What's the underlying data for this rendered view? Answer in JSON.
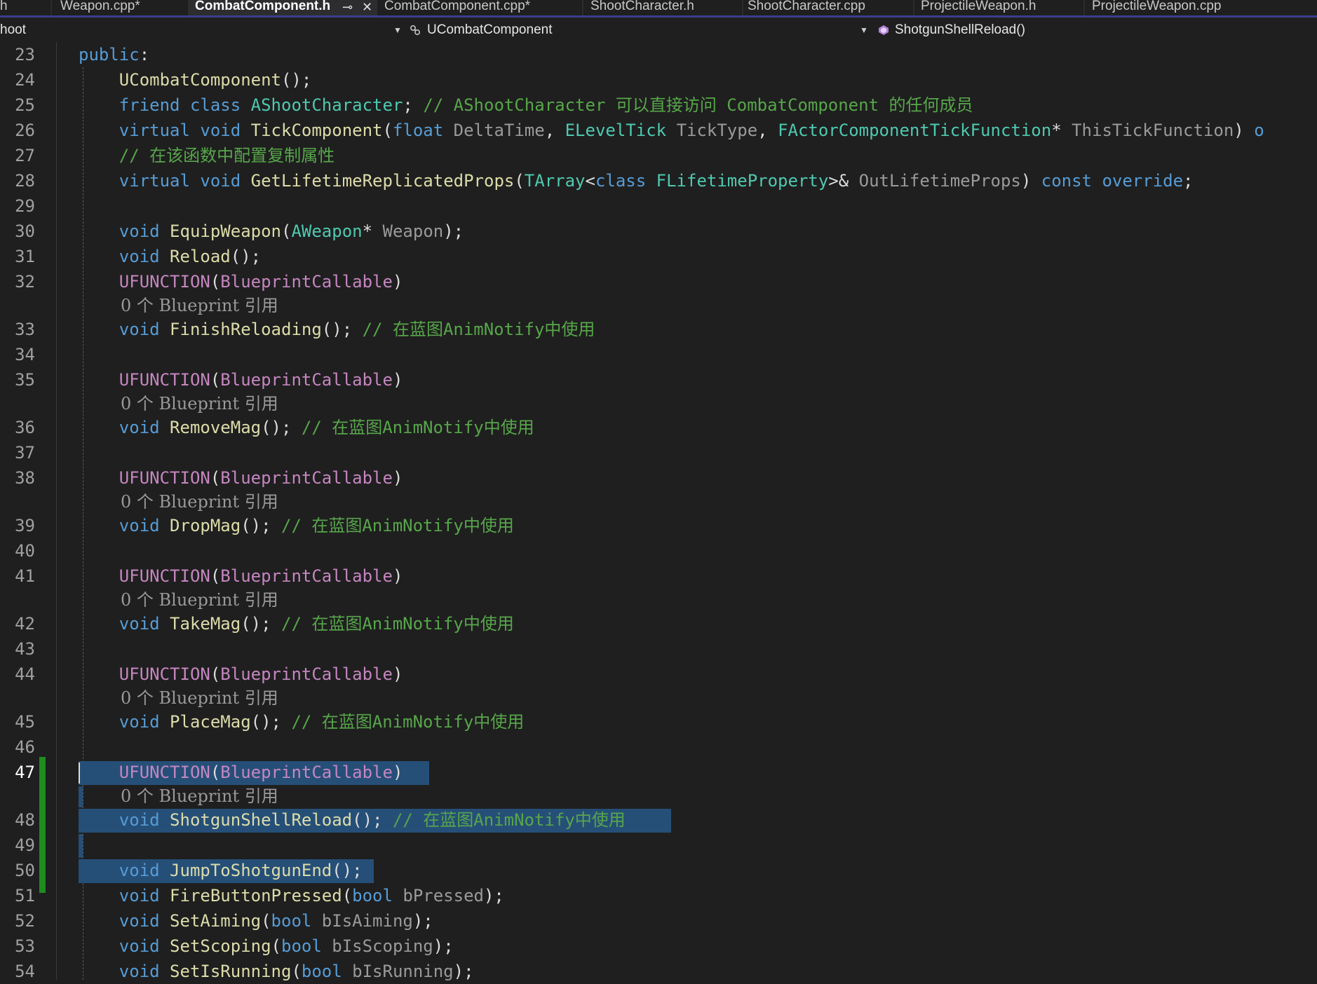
{
  "tabs": [
    {
      "label": "h",
      "active": false
    },
    {
      "label": "Weapon.cpp*",
      "active": false
    },
    {
      "label": "CombatComponent.h",
      "active": true,
      "pin_icon": "pin-icon",
      "close_icon": "close-icon"
    },
    {
      "label": "CombatComponent.cpp*",
      "active": false
    },
    {
      "label": "ShootCharacter.h",
      "active": false
    },
    {
      "label": "ShootCharacter.cpp",
      "active": false
    },
    {
      "label": "ProjectileWeapon.h",
      "active": false
    },
    {
      "label": "ProjectileWeapon.cpp",
      "active": false
    }
  ],
  "navbar": {
    "project": "hoot",
    "class_scope": "UCombatComponent",
    "class_icon": "class-scope-icon",
    "member": "ShotgunShellReload()",
    "member_icon": "method-icon",
    "dropdown_icon": "chevron-down-icon"
  },
  "colors": {
    "keyword": "#569cd6",
    "type": "#4ec9b0",
    "function": "#dcdcaa",
    "comment": "#57a64a",
    "macro": "#c586c0",
    "selection": "#264f78",
    "change_bar": "#1e8c1e"
  },
  "editor": {
    "current_line": "47",
    "lines": [
      {
        "num": "23",
        "tokens": [
          [
            "kw",
            "public"
          ],
          [
            "pn",
            ":"
          ]
        ]
      },
      {
        "num": "24",
        "tokens": [
          [
            "pn",
            "    "
          ],
          [
            "fn",
            "UCombatComponent"
          ],
          [
            "pn",
            "();"
          ]
        ]
      },
      {
        "num": "25",
        "tokens": [
          [
            "pn",
            "    "
          ],
          [
            "kw",
            "friend"
          ],
          [
            "pn",
            " "
          ],
          [
            "kw",
            "class"
          ],
          [
            "pn",
            " "
          ],
          [
            "ty",
            "AShootCharacter"
          ],
          [
            "pn",
            "; "
          ],
          [
            "cm",
            "// AShootCharacter 可以直接访问 CombatComponent 的任何成员"
          ]
        ]
      },
      {
        "num": "26",
        "tokens": [
          [
            "pn",
            "    "
          ],
          [
            "kw",
            "virtual"
          ],
          [
            "pn",
            " "
          ],
          [
            "kw",
            "void"
          ],
          [
            "pn",
            " "
          ],
          [
            "fn",
            "TickComponent"
          ],
          [
            "pn",
            "("
          ],
          [
            "kw",
            "float"
          ],
          [
            "pn",
            " "
          ],
          [
            "pa",
            "DeltaTime"
          ],
          [
            "pn",
            ", "
          ],
          [
            "ty",
            "ELevelTick"
          ],
          [
            "pn",
            " "
          ],
          [
            "pa",
            "TickType"
          ],
          [
            "pn",
            ", "
          ],
          [
            "ty",
            "FActorComponentTickFunction"
          ],
          [
            "pn",
            "* "
          ],
          [
            "pa",
            "ThisTickFunction"
          ],
          [
            "pn",
            ") "
          ],
          [
            "kw",
            "o"
          ]
        ]
      },
      {
        "num": "27",
        "tokens": [
          [
            "pn",
            "    "
          ],
          [
            "cm",
            "// 在该函数中配置复制属性"
          ]
        ]
      },
      {
        "num": "28",
        "tokens": [
          [
            "pn",
            "    "
          ],
          [
            "kw",
            "virtual"
          ],
          [
            "pn",
            " "
          ],
          [
            "kw",
            "void"
          ],
          [
            "pn",
            " "
          ],
          [
            "fn",
            "GetLifetimeReplicatedProps"
          ],
          [
            "pn",
            "("
          ],
          [
            "ty",
            "TArray"
          ],
          [
            "pn",
            "<"
          ],
          [
            "kw",
            "class"
          ],
          [
            "pn",
            " "
          ],
          [
            "ty",
            "FLifetimeProperty"
          ],
          [
            "pn",
            ">& "
          ],
          [
            "pa",
            "OutLifetimeProps"
          ],
          [
            "pn",
            ") "
          ],
          [
            "kw",
            "const"
          ],
          [
            "pn",
            " "
          ],
          [
            "kw",
            "override"
          ],
          [
            "pn",
            ";"
          ]
        ]
      },
      {
        "num": "29",
        "tokens": []
      },
      {
        "num": "30",
        "tokens": [
          [
            "pn",
            "    "
          ],
          [
            "kw",
            "void"
          ],
          [
            "pn",
            " "
          ],
          [
            "fn",
            "EquipWeapon"
          ],
          [
            "pn",
            "("
          ],
          [
            "ty",
            "AWeapon"
          ],
          [
            "pn",
            "* "
          ],
          [
            "pa",
            "Weapon"
          ],
          [
            "pn",
            ");"
          ]
        ]
      },
      {
        "num": "31",
        "tokens": [
          [
            "pn",
            "    "
          ],
          [
            "kw",
            "void"
          ],
          [
            "pn",
            " "
          ],
          [
            "fn",
            "Reload"
          ],
          [
            "pn",
            "();"
          ]
        ]
      },
      {
        "num": "32",
        "tokens": [
          [
            "pn",
            "    "
          ],
          [
            "mc",
            "UFUNCTION"
          ],
          [
            "pn",
            "("
          ],
          [
            "mc",
            "BlueprintCallable"
          ],
          [
            "pn",
            ")"
          ]
        ]
      },
      {
        "lens": "0 个 Blueprint 引用"
      },
      {
        "num": "33",
        "tokens": [
          [
            "pn",
            "    "
          ],
          [
            "kw",
            "void"
          ],
          [
            "pn",
            " "
          ],
          [
            "fn",
            "FinishReloading"
          ],
          [
            "pn",
            "(); "
          ],
          [
            "cm",
            "// 在蓝图AnimNotify中使用"
          ]
        ]
      },
      {
        "num": "34",
        "tokens": []
      },
      {
        "num": "35",
        "tokens": [
          [
            "pn",
            "    "
          ],
          [
            "mc",
            "UFUNCTION"
          ],
          [
            "pn",
            "("
          ],
          [
            "mc",
            "BlueprintCallable"
          ],
          [
            "pn",
            ")"
          ]
        ]
      },
      {
        "lens": "0 个 Blueprint 引用"
      },
      {
        "num": "36",
        "tokens": [
          [
            "pn",
            "    "
          ],
          [
            "kw",
            "void"
          ],
          [
            "pn",
            " "
          ],
          [
            "fn",
            "RemoveMag"
          ],
          [
            "pn",
            "(); "
          ],
          [
            "cm",
            "// 在蓝图AnimNotify中使用"
          ]
        ]
      },
      {
        "num": "37",
        "tokens": []
      },
      {
        "num": "38",
        "tokens": [
          [
            "pn",
            "    "
          ],
          [
            "mc",
            "UFUNCTION"
          ],
          [
            "pn",
            "("
          ],
          [
            "mc",
            "BlueprintCallable"
          ],
          [
            "pn",
            ")"
          ]
        ]
      },
      {
        "lens": "0 个 Blueprint 引用"
      },
      {
        "num": "39",
        "tokens": [
          [
            "pn",
            "    "
          ],
          [
            "kw",
            "void"
          ],
          [
            "pn",
            " "
          ],
          [
            "fn",
            "DropMag"
          ],
          [
            "pn",
            "(); "
          ],
          [
            "cm",
            "// 在蓝图AnimNotify中使用"
          ]
        ]
      },
      {
        "num": "40",
        "tokens": []
      },
      {
        "num": "41",
        "tokens": [
          [
            "pn",
            "    "
          ],
          [
            "mc",
            "UFUNCTION"
          ],
          [
            "pn",
            "("
          ],
          [
            "mc",
            "BlueprintCallable"
          ],
          [
            "pn",
            ")"
          ]
        ]
      },
      {
        "lens": "0 个 Blueprint 引用"
      },
      {
        "num": "42",
        "tokens": [
          [
            "pn",
            "    "
          ],
          [
            "kw",
            "void"
          ],
          [
            "pn",
            " "
          ],
          [
            "fn",
            "TakeMag"
          ],
          [
            "pn",
            "(); "
          ],
          [
            "cm",
            "// 在蓝图AnimNotify中使用"
          ]
        ]
      },
      {
        "num": "43",
        "tokens": []
      },
      {
        "num": "44",
        "tokens": [
          [
            "pn",
            "    "
          ],
          [
            "mc",
            "UFUNCTION"
          ],
          [
            "pn",
            "("
          ],
          [
            "mc",
            "BlueprintCallable"
          ],
          [
            "pn",
            ")"
          ]
        ]
      },
      {
        "lens": "0 个 Blueprint 引用"
      },
      {
        "num": "45",
        "tokens": [
          [
            "pn",
            "    "
          ],
          [
            "kw",
            "void"
          ],
          [
            "pn",
            " "
          ],
          [
            "fn",
            "PlaceMag"
          ],
          [
            "pn",
            "(); "
          ],
          [
            "cm",
            "// 在蓝图AnimNotify中使用"
          ]
        ]
      },
      {
        "num": "46",
        "tokens": []
      },
      {
        "num": "47",
        "sel": true,
        "tokens": [
          [
            "pn",
            "    "
          ],
          [
            "mc",
            "UFUNCTION"
          ],
          [
            "pn",
            "("
          ],
          [
            "mc",
            "BlueprintCallable"
          ],
          [
            "pn",
            ")"
          ]
        ]
      },
      {
        "lens": "0 个 Blueprint 引用"
      },
      {
        "num": "48",
        "sel": true,
        "tokens": [
          [
            "pn",
            "    "
          ],
          [
            "kw",
            "void"
          ],
          [
            "pn",
            " "
          ],
          [
            "fn",
            "ShotgunShellReload"
          ],
          [
            "pn",
            "(); "
          ],
          [
            "cm",
            "// 在蓝图AnimNotify中使用"
          ]
        ]
      },
      {
        "num": "49",
        "sel": true,
        "tokens": []
      },
      {
        "num": "50",
        "sel": true,
        "tokens": [
          [
            "pn",
            "    "
          ],
          [
            "kw",
            "void"
          ],
          [
            "pn",
            " "
          ],
          [
            "fn",
            "JumpToShotgunEnd"
          ],
          [
            "pn",
            "();"
          ]
        ]
      },
      {
        "num": "51",
        "tokens": [
          [
            "pn",
            "    "
          ],
          [
            "kw",
            "void"
          ],
          [
            "pn",
            " "
          ],
          [
            "fn",
            "FireButtonPressed"
          ],
          [
            "pn",
            "("
          ],
          [
            "kw",
            "bool"
          ],
          [
            "pn",
            " "
          ],
          [
            "pa",
            "bPressed"
          ],
          [
            "pn",
            ");"
          ]
        ]
      },
      {
        "num": "52",
        "tokens": [
          [
            "pn",
            "    "
          ],
          [
            "kw",
            "void"
          ],
          [
            "pn",
            " "
          ],
          [
            "fn",
            "SetAiming"
          ],
          [
            "pn",
            "("
          ],
          [
            "kw",
            "bool"
          ],
          [
            "pn",
            " "
          ],
          [
            "pa",
            "bIsAiming"
          ],
          [
            "pn",
            ");"
          ]
        ]
      },
      {
        "num": "53",
        "tokens": [
          [
            "pn",
            "    "
          ],
          [
            "kw",
            "void"
          ],
          [
            "pn",
            " "
          ],
          [
            "fn",
            "SetScoping"
          ],
          [
            "pn",
            "("
          ],
          [
            "kw",
            "bool"
          ],
          [
            "pn",
            " "
          ],
          [
            "pa",
            "bIsScoping"
          ],
          [
            "pn",
            ");"
          ]
        ]
      },
      {
        "num": "54",
        "tokens": [
          [
            "pn",
            "    "
          ],
          [
            "kw",
            "void"
          ],
          [
            "pn",
            " "
          ],
          [
            "fn",
            "SetIsRunning"
          ],
          [
            "pn",
            "("
          ],
          [
            "kw",
            "bool"
          ],
          [
            "pn",
            " "
          ],
          [
            "pa",
            "bIsRunning"
          ],
          [
            "pn",
            ");"
          ]
        ]
      }
    ]
  }
}
